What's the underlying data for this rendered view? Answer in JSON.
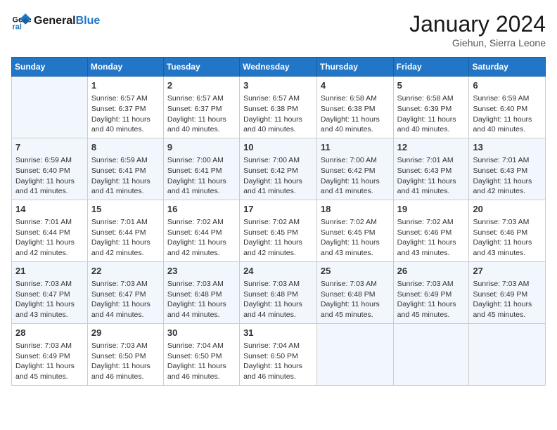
{
  "header": {
    "logo_line1": "General",
    "logo_line2": "Blue",
    "month": "January 2024",
    "location": "Giehun, Sierra Leone"
  },
  "weekdays": [
    "Sunday",
    "Monday",
    "Tuesday",
    "Wednesday",
    "Thursday",
    "Friday",
    "Saturday"
  ],
  "weeks": [
    [
      {
        "day": "",
        "text": ""
      },
      {
        "day": "1",
        "text": "Sunrise: 6:57 AM\nSunset: 6:37 PM\nDaylight: 11 hours\nand 40 minutes."
      },
      {
        "day": "2",
        "text": "Sunrise: 6:57 AM\nSunset: 6:37 PM\nDaylight: 11 hours\nand 40 minutes."
      },
      {
        "day": "3",
        "text": "Sunrise: 6:57 AM\nSunset: 6:38 PM\nDaylight: 11 hours\nand 40 minutes."
      },
      {
        "day": "4",
        "text": "Sunrise: 6:58 AM\nSunset: 6:38 PM\nDaylight: 11 hours\nand 40 minutes."
      },
      {
        "day": "5",
        "text": "Sunrise: 6:58 AM\nSunset: 6:39 PM\nDaylight: 11 hours\nand 40 minutes."
      },
      {
        "day": "6",
        "text": "Sunrise: 6:59 AM\nSunset: 6:40 PM\nDaylight: 11 hours\nand 40 minutes."
      }
    ],
    [
      {
        "day": "7",
        "text": "Sunrise: 6:59 AM\nSunset: 6:40 PM\nDaylight: 11 hours\nand 41 minutes."
      },
      {
        "day": "8",
        "text": "Sunrise: 6:59 AM\nSunset: 6:41 PM\nDaylight: 11 hours\nand 41 minutes."
      },
      {
        "day": "9",
        "text": "Sunrise: 7:00 AM\nSunset: 6:41 PM\nDaylight: 11 hours\nand 41 minutes."
      },
      {
        "day": "10",
        "text": "Sunrise: 7:00 AM\nSunset: 6:42 PM\nDaylight: 11 hours\nand 41 minutes."
      },
      {
        "day": "11",
        "text": "Sunrise: 7:00 AM\nSunset: 6:42 PM\nDaylight: 11 hours\nand 41 minutes."
      },
      {
        "day": "12",
        "text": "Sunrise: 7:01 AM\nSunset: 6:43 PM\nDaylight: 11 hours\nand 41 minutes."
      },
      {
        "day": "13",
        "text": "Sunrise: 7:01 AM\nSunset: 6:43 PM\nDaylight: 11 hours\nand 42 minutes."
      }
    ],
    [
      {
        "day": "14",
        "text": "Sunrise: 7:01 AM\nSunset: 6:44 PM\nDaylight: 11 hours\nand 42 minutes."
      },
      {
        "day": "15",
        "text": "Sunrise: 7:01 AM\nSunset: 6:44 PM\nDaylight: 11 hours\nand 42 minutes."
      },
      {
        "day": "16",
        "text": "Sunrise: 7:02 AM\nSunset: 6:44 PM\nDaylight: 11 hours\nand 42 minutes."
      },
      {
        "day": "17",
        "text": "Sunrise: 7:02 AM\nSunset: 6:45 PM\nDaylight: 11 hours\nand 42 minutes."
      },
      {
        "day": "18",
        "text": "Sunrise: 7:02 AM\nSunset: 6:45 PM\nDaylight: 11 hours\nand 43 minutes."
      },
      {
        "day": "19",
        "text": "Sunrise: 7:02 AM\nSunset: 6:46 PM\nDaylight: 11 hours\nand 43 minutes."
      },
      {
        "day": "20",
        "text": "Sunrise: 7:03 AM\nSunset: 6:46 PM\nDaylight: 11 hours\nand 43 minutes."
      }
    ],
    [
      {
        "day": "21",
        "text": "Sunrise: 7:03 AM\nSunset: 6:47 PM\nDaylight: 11 hours\nand 43 minutes."
      },
      {
        "day": "22",
        "text": "Sunrise: 7:03 AM\nSunset: 6:47 PM\nDaylight: 11 hours\nand 44 minutes."
      },
      {
        "day": "23",
        "text": "Sunrise: 7:03 AM\nSunset: 6:48 PM\nDaylight: 11 hours\nand 44 minutes."
      },
      {
        "day": "24",
        "text": "Sunrise: 7:03 AM\nSunset: 6:48 PM\nDaylight: 11 hours\nand 44 minutes."
      },
      {
        "day": "25",
        "text": "Sunrise: 7:03 AM\nSunset: 6:48 PM\nDaylight: 11 hours\nand 45 minutes."
      },
      {
        "day": "26",
        "text": "Sunrise: 7:03 AM\nSunset: 6:49 PM\nDaylight: 11 hours\nand 45 minutes."
      },
      {
        "day": "27",
        "text": "Sunrise: 7:03 AM\nSunset: 6:49 PM\nDaylight: 11 hours\nand 45 minutes."
      }
    ],
    [
      {
        "day": "28",
        "text": "Sunrise: 7:03 AM\nSunset: 6:49 PM\nDaylight: 11 hours\nand 45 minutes."
      },
      {
        "day": "29",
        "text": "Sunrise: 7:03 AM\nSunset: 6:50 PM\nDaylight: 11 hours\nand 46 minutes."
      },
      {
        "day": "30",
        "text": "Sunrise: 7:04 AM\nSunset: 6:50 PM\nDaylight: 11 hours\nand 46 minutes."
      },
      {
        "day": "31",
        "text": "Sunrise: 7:04 AM\nSunset: 6:50 PM\nDaylight: 11 hours\nand 46 minutes."
      },
      {
        "day": "",
        "text": ""
      },
      {
        "day": "",
        "text": ""
      },
      {
        "day": "",
        "text": ""
      }
    ]
  ]
}
